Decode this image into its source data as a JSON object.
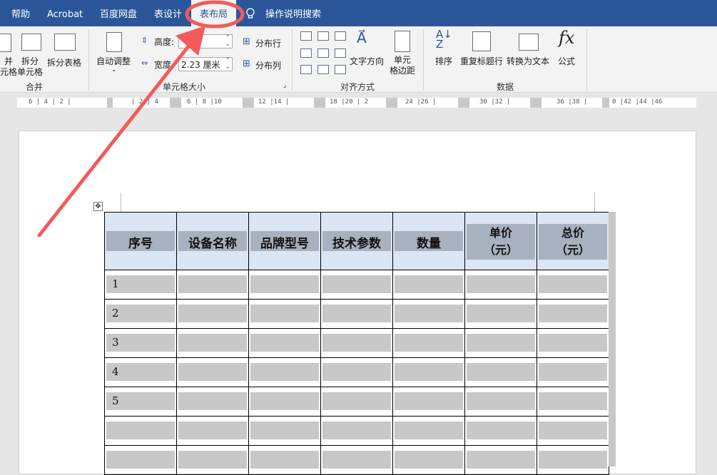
{
  "tabs": [
    "帮助",
    "Acrobat",
    "百度网盘",
    "表设计",
    "表布局",
    "操作说明搜索"
  ],
  "ribbon": {
    "merge_group": {
      "label": "合并",
      "merge_cells": [
        "并",
        "元格"
      ],
      "split_cells": [
        "拆分",
        "单元格"
      ],
      "split_table": "拆分表格"
    },
    "cell_size_group": {
      "label": "单元格大小",
      "autofit": "自动调整",
      "height_label": "高度:",
      "height_value": "",
      "width_label": "宽度",
      "width_value": "2.23 厘米",
      "distribute_rows": "分布行",
      "distribute_cols": "分布列"
    },
    "align_group": {
      "label": "对齐方式",
      "text_direction": "文字方向",
      "cell_margins": [
        "单元",
        "格边距"
      ]
    },
    "data_group": {
      "label": "数据",
      "sort": "排序",
      "repeat_header": "重复标题行",
      "convert_text": "转换为文本",
      "formula": "公式",
      "fx": "fx"
    }
  },
  "ruler": {
    "segments": [
      "6 | 4 | 2 |",
      "| 2 | 4",
      "6 | 8 |10",
      "12 |14 |",
      "18 |20 | 2",
      "24 |26 |",
      "30 |32 |",
      "36 |38 |",
      "0 |42 |44 |46"
    ]
  },
  "table": {
    "headers": [
      "序号",
      "设备名称",
      "品牌型号",
      "技术参数",
      "数量",
      "单价",
      "总价"
    ],
    "header_sub": [
      "",
      "",
      "",
      "",
      "",
      "（元）",
      "（元）"
    ],
    "rows": [
      "1",
      "2",
      "3",
      "4",
      "5",
      "",
      ""
    ]
  },
  "colors": {
    "accent": "#2b579a",
    "annotation": "#f25b5b"
  }
}
